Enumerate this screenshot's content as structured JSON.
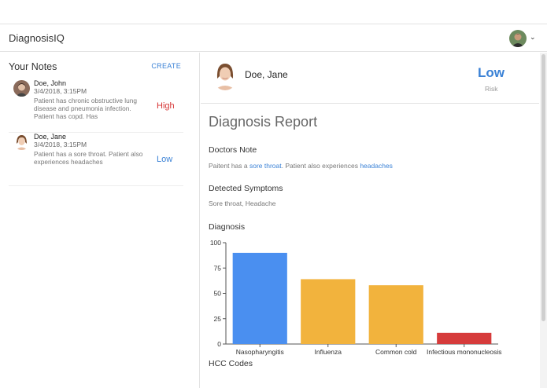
{
  "app": {
    "title": "DiagnosisIQ"
  },
  "header": {
    "chevron": "⌄"
  },
  "sidebar": {
    "title": "Your Notes",
    "create_label": "CREATE",
    "notes": [
      {
        "name": "Doe, John",
        "date": "3/4/2018, 3:15PM",
        "text": "Patient has chronic obstructive lung disease and pneumonia infection. Patient has copd. Has",
        "risk": "High"
      },
      {
        "name": "Doe, Jane",
        "date": "3/4/2018, 3:15PM",
        "text": "Patient has a sore throat. Patient also experiences headaches",
        "risk": "Low"
      }
    ]
  },
  "patient": {
    "name": "Doe, Jane",
    "risk": "Low",
    "risk_label": "Risk"
  },
  "report": {
    "title": "Diagnosis Report",
    "doctors_note_title": "Doctors Note",
    "note_parts": [
      "Paitent has a ",
      "sore throat",
      ". Patient also experiences ",
      "headaches"
    ],
    "symptoms_title": "Detected Symptoms",
    "symptoms": "Sore throat, Headache",
    "diagnosis_title": "Diagnosis",
    "hcc_title": "HCC Codes"
  },
  "colors": {
    "accent": "#3b82d6",
    "high": "#d63333",
    "bar_blue": "#4a8ff0",
    "bar_orange": "#f2b33d",
    "bar_red": "#d63b3b"
  },
  "chart_data": {
    "type": "bar",
    "categories": [
      "Nasopharyngitis",
      "Influenza",
      "Common cold",
      "Infectious mononucleosis"
    ],
    "values": [
      90,
      64,
      58,
      11
    ],
    "bar_colors": [
      "#4a8ff0",
      "#f2b33d",
      "#f2b33d",
      "#d63b3b"
    ],
    "ylim": [
      0,
      100
    ],
    "yticks": [
      0,
      25,
      50,
      75,
      100
    ],
    "title": "",
    "xlabel": "",
    "ylabel": ""
  }
}
